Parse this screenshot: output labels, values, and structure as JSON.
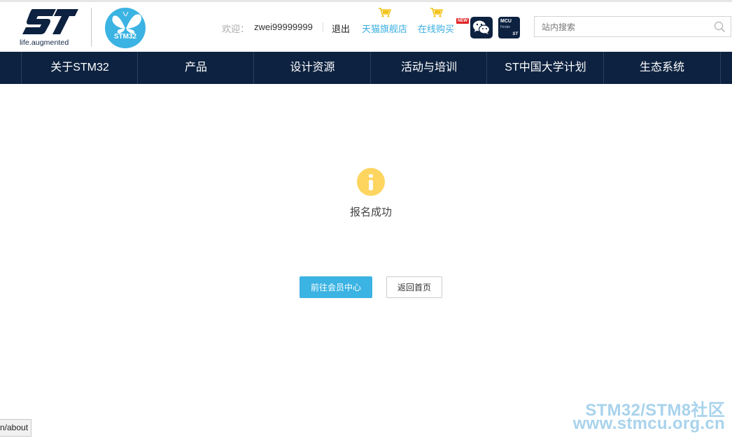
{
  "header": {
    "st_logo_text": "ST",
    "st_tagline": "life.augmented",
    "stm32_logo_text": "STM32",
    "welcome_label": "欢迎：",
    "username": "zwei99999999",
    "logout_label": "退出",
    "tmall_store_label": "天猫旗舰店",
    "online_buy_label": "在线购买",
    "new_badge": "NEW",
    "mcu_finder": {
      "title": "MCU",
      "subtitle": "Finder",
      "brand": "ST"
    },
    "search_placeholder": "站内搜索"
  },
  "nav": {
    "items": [
      {
        "label": "关于STM32"
      },
      {
        "label": "产品"
      },
      {
        "label": "设计资源"
      },
      {
        "label": "活动与培训"
      },
      {
        "label": "ST中国大学计划"
      },
      {
        "label": "生态系统"
      }
    ]
  },
  "main": {
    "message": "报名成功",
    "primary_button": "前往会员中心",
    "secondary_button": "返回首页"
  },
  "status_bar": {
    "url": "n/about"
  },
  "watermark": {
    "line1": "STM32/STM8社区",
    "line2": "www.stmcu.org.cn"
  },
  "colors": {
    "nav_background": "#0d2240",
    "accent_blue": "#3bb3e3",
    "link_blue": "#3aaee0",
    "info_icon_yellow": "#fdd55f",
    "cart_yellow": "#f3c318",
    "new_badge_red": "#e0262a"
  },
  "icons": [
    "shopping-cart-icon",
    "wechat-icon",
    "mcu-finder-icon",
    "search-icon",
    "info-icon",
    "butterfly-icon"
  ]
}
